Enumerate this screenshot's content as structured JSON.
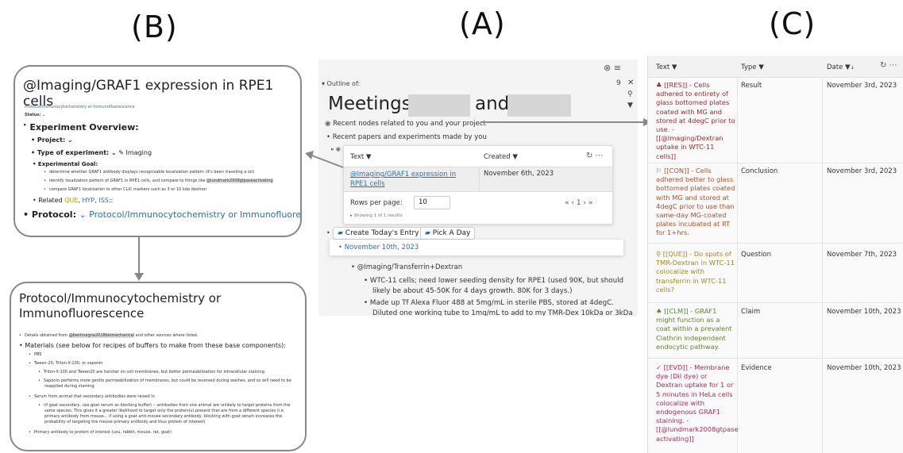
{
  "labels": {
    "a": "(A)",
    "b": "(B)",
    "c": "(C)"
  },
  "panel_b": {
    "card1": {
      "title": "@Imaging/GRAF1 expression in RPE1 cells",
      "breadcrumb": "Protocol/Immunocytochemistry or Immunofluorescence",
      "status": "Status: ⌄",
      "section": "Experiment Overview:",
      "project": "Project: ⌄",
      "type_label": "Type of experiment: ⌄",
      "type_value": "Imaging",
      "goal": "Experimental Goal:",
      "goal_items": [
        "determine whether GRAF1 antibody displays recognizable localization pattern (it's been traveling a lot)",
        "identify localization pattern of GRAF1 in RPE1 cells, and compare to things like",
        "compare GRAF1 localization to other CLIC markers such as 3 or 10 kda dextran"
      ],
      "goal_ref": "@lundmark2008gtpaseactivating",
      "related_prefix": "Related",
      "related_que": "QUE",
      "related_hyp": "HYP",
      "related_iss": "ISS",
      "protocol_label": "Protocol:",
      "protocol_value": "⌄ Protocol/Immunocytochemistry or Immunofluorescence"
    },
    "card2": {
      "title_line1": "Protocol/Immunocytochemistry or",
      "title_line2": "Immunofluorescence",
      "details_prefix": "Details obtained from",
      "details_ref": "@bentivegna2018biomechanical",
      "details_suffix": "and other sources where listed.",
      "materials": "Materials (see below for recipes of buffers to make from these base components):",
      "items": [
        "PBS",
        "Tween-20, Triton-X-100, or saponin",
        "Triton-X-100 and Tween20 are harsher on cell membranes, but better permeabilization for intracellular staining",
        "Saponin performs more gentle permeabilization of membranes, but could be reversed during washes, and so will need to be",
        "reapplied during staining",
        "Serum from animal that secondary antibodies were raised in",
        "(if goat secondary, use goat serum as blocking buffer) -- antibodies from one animal are unlikely to target proteins from the",
        "same species. This gives it a greater likelihood to target only the protein(s) present that are from a different species (i.e.",
        "primary antibody from mouse... if using a goat anti-mouse secondary antibody, blocking with goat serum increases the",
        "probability of targeting the mouse primary antibody and thus protein of interest)",
        "Primary antibody to protein of interest (usu, rabbit, mouse, rat, goat)"
      ]
    }
  },
  "panel_a": {
    "outline_label": "▾ Outline of:",
    "count": "9",
    "title_word1": "Meetings",
    "title_word2": "and",
    "recent_nodes": "Recent nodes related to you and your project",
    "recent_papers": "Recent papers and experiments made by you",
    "table": {
      "col_text": "Text",
      "col_created": "Created",
      "row_text": "@Imaging/GRAF1 expression in RPE1 cells",
      "row_date": "November 6th, 2023",
      "rows_per_page_label": "Rows per page:",
      "rows_per_page_value": "10",
      "pager": "«  ‹ 1 ›  »",
      "showing": "▸ Showing 1 of 1 results"
    },
    "btn_today": "Create Today's Entry",
    "btn_pick": "Pick A Day",
    "date_node": "November 10th, 2023",
    "sub_node": "@Imaging/Transferrin+Dextran",
    "notes": [
      "WTC-11 cells; need lower seeding density for RPE1 (used 90K, but should",
      "likely be about 45-50K for 4 days growth. 80K for 3 days.)",
      "Made up Tf Alexa Fluor 488 at 5mg/mL in sterile PBS, stored at 4degC.",
      "Diluted one working tube to 1mg/mL to add to my TMR-Dex 10kDa or 3kDa"
    ]
  },
  "panel_c": {
    "headers": {
      "text": "Text",
      "type": "Type",
      "date": "Date"
    },
    "rows": [
      {
        "text": "♣ [[RES]] - Cells adhered to entirety of glass bottomed plates coated with MG and stored at 4degC prior to use. - [[@Imaging/Dextran uptake in WTC-11 cells]]",
        "type": "Result",
        "date": "November 3rd, 2023",
        "color": "#9a2a2a"
      },
      {
        "text": "⚐ [[CON]] - Cells adhered better to glass bottomed plates coated with MG and stored at 4degC prior to use than same-day MG-coated plates incubated at RT for 1+hrs.",
        "type": "Conclusion",
        "date": "November 3rd, 2023",
        "color": "#b0502a"
      },
      {
        "text": "⚲ [[QUE]] - Do spots of TMR-Dextran in WTC-11 colocalize with transferrin in WTC-11 cells?",
        "type": "Question",
        "date": "November 7th, 2023",
        "color": "#9b8a1e"
      },
      {
        "text": "♠ [[CLM]] - GRAF1 might function as a coat within a prevalent Clathrin independent endocytic pathway.",
        "type": "Claim",
        "date": "November 10th, 2023",
        "color": "#5a8a2a"
      },
      {
        "text": "✓ [[EVD]] - Membrane dye (Dil dye) or Dextran uptake for 1 or 5 minutes in HeLa cells colocalize with endogenous GRAF1 staining. - [[@lundmark2008gtpase activating]]",
        "type": "Evidence",
        "date": "November 10th, 2023",
        "color": "#b0285a"
      }
    ]
  },
  "colors": {
    "arrow": "#888888",
    "link": "#2f6fb0",
    "redact": "#d6d6d6"
  }
}
